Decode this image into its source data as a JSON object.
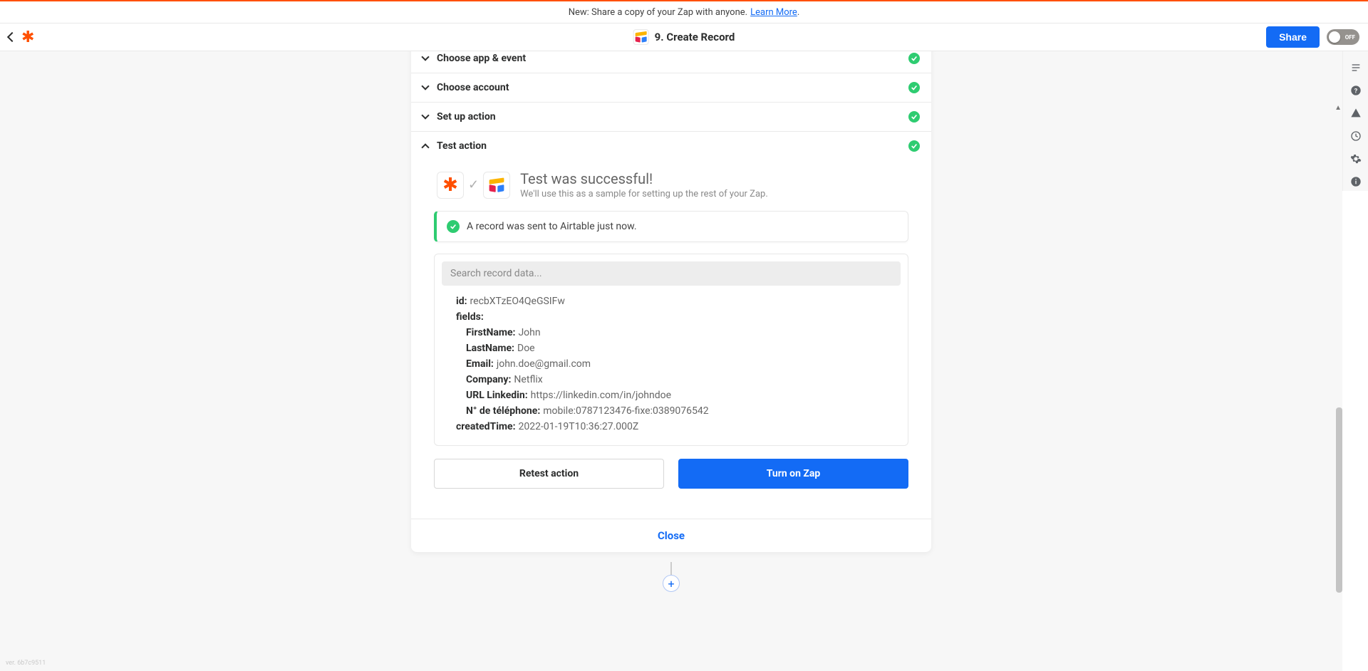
{
  "banner": {
    "text": "New: Share a copy of your Zap with anyone.",
    "link_label": "Learn More"
  },
  "topbar": {
    "title": "9. Create Record",
    "share_label": "Share",
    "toggle_label": "OFF"
  },
  "sections": {
    "choose_app": "Choose app & event",
    "choose_account": "Choose account",
    "setup_action": "Set up action",
    "test_action": "Test action"
  },
  "test": {
    "heading": "Test was successful!",
    "subheading": "We'll use this as a sample for setting up the rest of your Zap.",
    "banner_msg": "A record was sent to Airtable just now.",
    "search_placeholder": "Search record data...",
    "record": {
      "id_key": "id:",
      "id_val": "recbXTzEO4QeGSIFw",
      "fields_key": "fields:",
      "firstname_key": "FirstName:",
      "firstname_val": "John",
      "lastname_key": "LastName:",
      "lastname_val": "Doe",
      "email_key": "Email:",
      "email_val": "john.doe@gmail.com",
      "company_key": "Company:",
      "company_val": "Netflix",
      "linkedin_key": "URL Linkedin:",
      "linkedin_val": "https://linkedin.com/in/johndoe",
      "phone_key": "N° de téléphone:",
      "phone_val": "mobile:0787123476-fixe:0389076542",
      "created_key": "createdTime:",
      "created_val": "2022-01-19T10:36:27.000Z"
    }
  },
  "buttons": {
    "retest": "Retest action",
    "turn_on": "Turn on Zap",
    "close": "Close"
  },
  "footer": {
    "version": "ver. 6b7c9511"
  }
}
